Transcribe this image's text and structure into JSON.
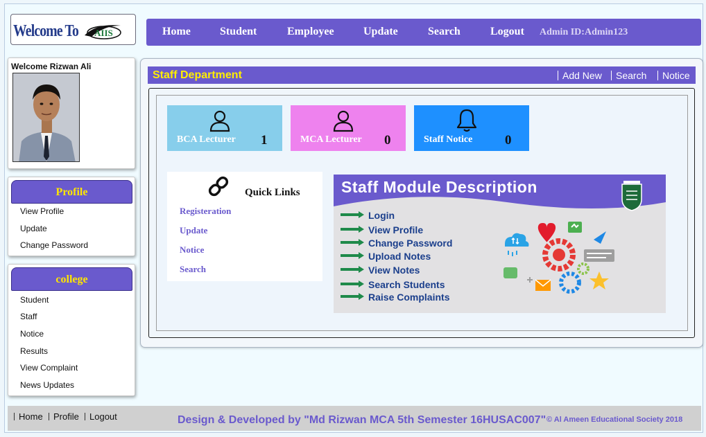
{
  "header": {
    "logo_text": "Welcome To",
    "logo_brand": "AIIS",
    "nav": [
      {
        "label": "Home"
      },
      {
        "label": "Student"
      },
      {
        "label": "Employee"
      },
      {
        "label": "Update"
      },
      {
        "label": "Search"
      },
      {
        "label": "Logout"
      }
    ],
    "admin_id": "Admin ID:Admin123"
  },
  "sidebar": {
    "welcome": "Welcome Rizwan Ali",
    "profile_menu": {
      "title": "Profile",
      "items": [
        {
          "label": "View Profile"
        },
        {
          "label": "Update"
        },
        {
          "label": "Change Password"
        }
      ]
    },
    "college_menu": {
      "title": "college",
      "items": [
        {
          "label": "Student"
        },
        {
          "label": "Staff"
        },
        {
          "label": "Notice"
        },
        {
          "label": "Results"
        },
        {
          "label": "View Complaint"
        },
        {
          "label": "News Updates"
        }
      ]
    }
  },
  "main": {
    "title": "Staff Department",
    "links": [
      {
        "label": "Add New"
      },
      {
        "label": "Search"
      },
      {
        "label": "Notice"
      }
    ],
    "tiles": [
      {
        "label": "BCA Lecturer",
        "count": "1",
        "icon": "user-icon",
        "color": "#87ceeb"
      },
      {
        "label": "MCA Lecturer",
        "count": "0",
        "icon": "user-icon",
        "color": "#ee82ee"
      },
      {
        "label": "Staff Notice",
        "count": "0",
        "icon": "bell-icon",
        "color": "#1e90ff"
      }
    ],
    "quick_links": {
      "title": "Quick Links",
      "items": [
        {
          "label": "Registeration"
        },
        {
          "label": "Update"
        },
        {
          "label": "Notice"
        },
        {
          "label": "Search"
        }
      ]
    },
    "description": {
      "title": "Staff Module Description",
      "items": [
        "Login",
        "View Profile",
        "Change Password",
        "Upload Notes",
        "View Notes",
        "Search Students",
        "Raise Complaints"
      ]
    }
  },
  "footer": {
    "links": [
      {
        "label": "Home"
      },
      {
        "label": "Profile"
      },
      {
        "label": "Logout"
      }
    ],
    "credit": "Design & Developed by \"Md Rizwan MCA 5th Semester 16HUSAC007\"",
    "copyright": "© Al Ameen Educational Society 2018"
  },
  "colors": {
    "accent": "#6a5acd",
    "heading_yellow": "#ffee00"
  }
}
